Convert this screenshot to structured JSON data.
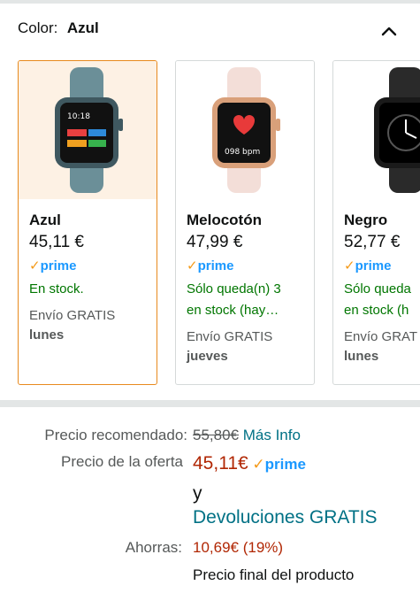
{
  "color_selector": {
    "label": "Color:",
    "selected": "Azul"
  },
  "variants": [
    {
      "name": "Azul",
      "price": "45,11 €",
      "prime": "prime",
      "stock": "En stock.",
      "stock2": "",
      "shipping": "Envío GRATIS",
      "delivery_day": "lunes",
      "strap_color": "#6b8f98",
      "selected": true
    },
    {
      "name": "Melocotón",
      "price": "47,99 €",
      "prime": "prime",
      "stock": "Sólo queda(n) 3",
      "stock2": "en stock (hay…",
      "shipping": "Envío GRATIS",
      "delivery_day": "jueves",
      "strap_color": "#f3ded8",
      "selected": false
    },
    {
      "name": "Negro",
      "price": "52,77 €",
      "prime": "prime",
      "stock": "Sólo queda",
      "stock2": "en stock (h",
      "shipping": "Envío GRAT",
      "delivery_day": "lunes",
      "strap_color": "#2a2a2a",
      "selected": false
    }
  ],
  "pricing": {
    "rrp_label": "Precio recomendado:",
    "rrp_value": "55,80€",
    "more_info": "Más Info",
    "deal_label": "Precio de la oferta",
    "deal_value": "45,11€",
    "deal_prime": "prime",
    "and": "y",
    "returns": "Devoluciones GRATIS",
    "savings_label": "Ahorras:",
    "savings_value": "10,69€ (19%)",
    "final_price": "Precio final del producto"
  },
  "colors": {
    "selected_border": "#e88a1e",
    "prime_blue": "#1a98ff",
    "in_stock_green": "#007600",
    "deal_red": "#b12704",
    "link_teal": "#007185"
  }
}
